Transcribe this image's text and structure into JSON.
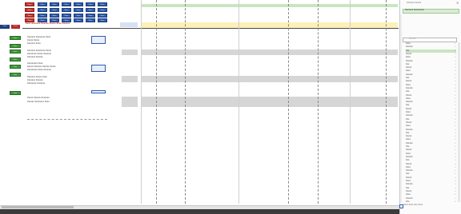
{
  "title_red": "Xxxx Xxxxxxx Xxxxxx Xxxxx Xxxx Xxxxxx",
  "nav_buttons": [
    "Xxxx",
    "Xxxx"
  ],
  "button_grid_labels": [
    "Xxxx",
    "Xxxx",
    "Xxxx",
    "Xxxx",
    "Xxxx",
    "Xxxx",
    "Xxxx",
    "Xxxx",
    "Xxxx",
    "Xxxx",
    "Xxxx",
    "Xxxx",
    "Xxxx",
    "Xxxx",
    "Xxxx",
    "Xxxx",
    "Xxxx",
    "Xxxx",
    "Xxxx",
    "Xxxx",
    "Xxxx",
    "Xxxx",
    "Xxxx",
    "Xxxx",
    "Xxxx",
    "Xxxx",
    "Xxxx",
    "Xxxx"
  ],
  "side_buttons": [
    "Xxx",
    "Xxx",
    "Xxx",
    "Xxx",
    "Xxx",
    "Xxx",
    "Xxx"
  ],
  "form_labels": [
    "Xxxxxxx Xxxxxxxx Xxxx",
    "Xxxxx Xxxxx",
    "Xxxxxxx Xxxx",
    "Xxxxxxx Xxxxxxxx Xxxxx",
    "Xxxxxxxx Xxxxx Xxxxxxx",
    "Xxxxxxx Xxxxxx",
    "Xxxxxxxxx Xxxx",
    "Xxxxx Xxxxxxx Xxxxxx Xxxxx",
    "Xxxxxxxxx Xxxx Xxxxxxx",
    "Xxxxxxx Xxxxx Xxxx",
    "Xxxxxxx Xxxxxx",
    "Xxxxxxxx Xxxxxxx",
    "Xxxxx Xxxxxx Xxxxxxx",
    "Xxxxxx Xxxxxxxx Xxxx"
  ],
  "panel": {
    "title": "Xxxxxxx Xxxxx",
    "search_placeholder": "Xxxxxx",
    "header": "Xxxxxxx Xxxxxxxxx",
    "items": [
      "Xxxx",
      "Xxxxxx",
      "Xxx",
      "Xxxxx",
      "Xxxx",
      "Xxxxxx",
      "Xxx",
      "Xxxxx",
      "Xxxx",
      "Xxxxxx",
      "Xxx",
      "Xxxxx",
      "Xxxx",
      "Xxxxxx",
      "Xxx",
      "Xxxxx",
      "Xxxx",
      "Xxxxxx",
      "Xxx",
      "Xxxxx",
      "Xxxx",
      "Xxxxxx",
      "Xxx",
      "Xxxxx",
      "Xxxx",
      "Xxxxxx",
      "Xxx",
      "Xxxxx",
      "Xxxx",
      "Xxxxxx",
      "Xxx",
      "Xxxxx",
      "Xxxx",
      "Xxxxxx",
      "Xxx",
      "Xxxxx",
      "Xxxx",
      "Xxxxxx",
      "Xxx",
      "Xxxxx",
      "Xxxx",
      "Xxxxxx",
      "Xxx",
      "Xxxxx",
      "Xxxx",
      "Xxxxxx",
      "Xxx"
    ],
    "footer": "Xxxx  Xxxx  Xxx  Xxxx"
  },
  "colors": {
    "yellow_band": "#fdf0b8",
    "green_band": "#c8e6c0",
    "gray_band": "#d6d6d6",
    "blue_button": "#2e5aa8",
    "red_button": "#c8342f",
    "green_button": "#3f9a3a"
  }
}
